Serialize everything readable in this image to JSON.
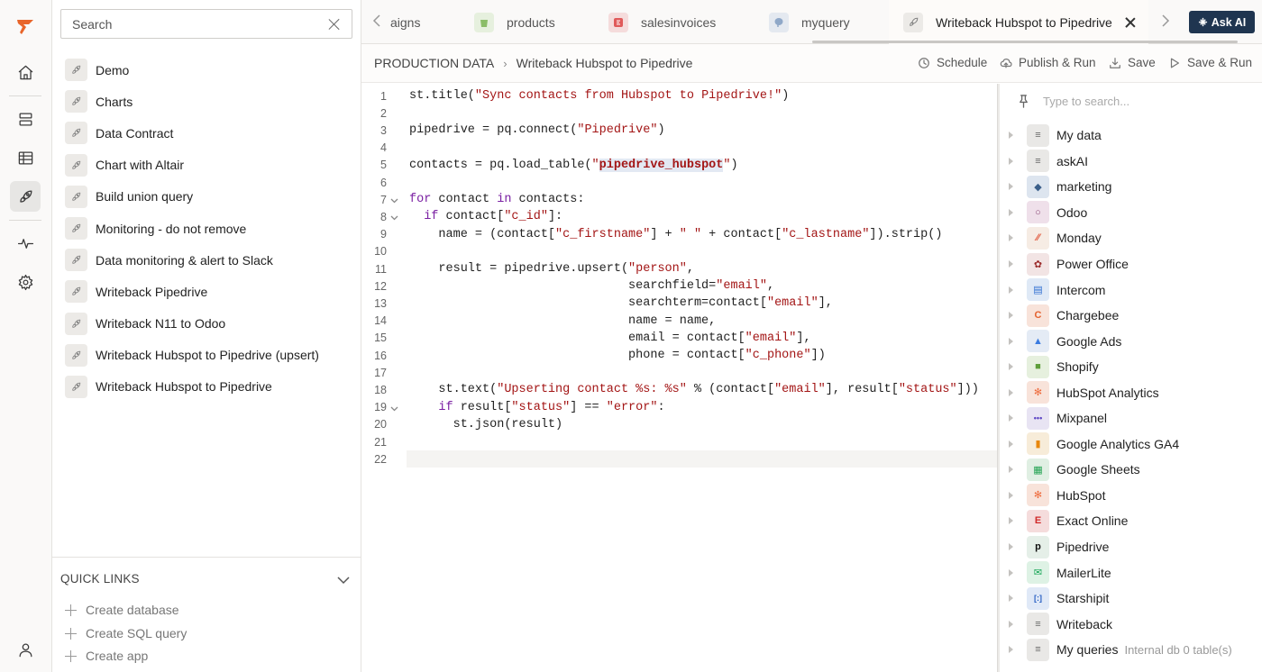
{
  "search": {
    "placeholder": "Search"
  },
  "apps": [
    {
      "label": "Demo"
    },
    {
      "label": "Charts"
    },
    {
      "label": "Data Contract"
    },
    {
      "label": "Chart with Altair"
    },
    {
      "label": "Build union query"
    },
    {
      "label": "Monitoring - do not remove"
    },
    {
      "label": "Data monitoring & alert to Slack"
    },
    {
      "label": "Writeback Pipedrive"
    },
    {
      "label": "Writeback N11 to Odoo"
    },
    {
      "label": "Writeback Hubspot to Pipedrive (upsert)"
    },
    {
      "label": "Writeback Hubspot to Pipedrive"
    }
  ],
  "quick_links": {
    "title": "QUICK LINKS",
    "items": [
      {
        "label": "Create database"
      },
      {
        "label": "Create SQL query"
      },
      {
        "label": "Create app"
      }
    ]
  },
  "tabs": [
    {
      "label": "aigns",
      "icon": "none"
    },
    {
      "label": "products",
      "icon": "shopify-icon"
    },
    {
      "label": "salesinvoices",
      "icon": "exact-online-icon"
    },
    {
      "label": "myquery",
      "icon": "postgres-icon"
    },
    {
      "label": "Writeback Hubspot to Pipedrive",
      "icon": "rocket-icon",
      "active": true
    }
  ],
  "ask_ai": {
    "label": "Ask AI"
  },
  "breadcrumb": {
    "root": "PRODUCTION DATA",
    "separator": "›",
    "current": "Writeback Hubspot to Pipedrive"
  },
  "toolbar": {
    "schedule": "Schedule",
    "publish_run": "Publish & Run",
    "save": "Save",
    "save_run": "Save & Run"
  },
  "editor": {
    "current_line": 22,
    "lines": [
      {
        "n": "1",
        "code": "st.title(\"Sync contacts from Hubspot to Pipedrive!\")"
      },
      {
        "n": "2",
        "code": ""
      },
      {
        "n": "3",
        "code": "pipedrive = pq.connect(\"Pipedrive\")"
      },
      {
        "n": "4",
        "code": ""
      },
      {
        "n": "5",
        "code": "contacts = pq.load_table(\"pipedrive_hubspot\")"
      },
      {
        "n": "6",
        "code": ""
      },
      {
        "n": "7",
        "code": "for contact in contacts:",
        "fold": true
      },
      {
        "n": "8",
        "code": "  if contact[\"c_id\"]:",
        "fold": true
      },
      {
        "n": "9",
        "code": "    name = (contact[\"c_firstname\"] + \" \" + contact[\"c_lastname\"]).strip()"
      },
      {
        "n": "10",
        "code": ""
      },
      {
        "n": "11",
        "code": "    result = pipedrive.upsert(\"person\","
      },
      {
        "n": "12",
        "code": "                              searchfield=\"email\","
      },
      {
        "n": "13",
        "code": "                              searchterm=contact[\"email\"],"
      },
      {
        "n": "14",
        "code": "                              name = name,"
      },
      {
        "n": "15",
        "code": "                              email = contact[\"email\"],"
      },
      {
        "n": "16",
        "code": "                              phone = contact[\"c_phone\"])"
      },
      {
        "n": "17",
        "code": ""
      },
      {
        "n": "18",
        "code": "    st.text(\"Upserting contact %s: %s\" % (contact[\"email\"], result[\"status\"]))"
      },
      {
        "n": "19",
        "code": "    if result[\"status\"] == \"error\":",
        "fold": true
      },
      {
        "n": "20",
        "code": "      st.json(result)"
      },
      {
        "n": "21",
        "code": ""
      },
      {
        "n": "22",
        "code": ""
      }
    ]
  },
  "data_panel": {
    "search_placeholder": "Type to search...",
    "items": [
      {
        "label": "My data",
        "icon": "database-icon",
        "bg": "#e9e8e6",
        "fg": "#666",
        "glyph": "≡"
      },
      {
        "label": "askAI",
        "icon": "database-icon",
        "bg": "#e9e8e6",
        "fg": "#666",
        "glyph": "≡"
      },
      {
        "label": "marketing",
        "icon": "postgres-icon",
        "bg": "#dde5ef",
        "fg": "#3b5f8a",
        "glyph": "◆"
      },
      {
        "label": "Odoo",
        "icon": "odoo-icon",
        "bg": "#efe0ea",
        "fg": "#8c4a78",
        "glyph": "○"
      },
      {
        "label": "Monday",
        "icon": "monday-icon",
        "bg": "#f6ece4",
        "fg": "#e0563b",
        "glyph": "⁄⁄"
      },
      {
        "label": "Power Office",
        "icon": "power-office-icon",
        "bg": "#f2e4e4",
        "fg": "#9b2a2a",
        "glyph": "✿"
      },
      {
        "label": "Intercom",
        "icon": "intercom-icon",
        "bg": "#dfe9f6",
        "fg": "#2f6fd1",
        "glyph": "▤"
      },
      {
        "label": "Chargebee",
        "icon": "chargebee-icon",
        "bg": "#f8e3da",
        "fg": "#e4622f",
        "glyph": "C"
      },
      {
        "label": "Google Ads",
        "icon": "google-ads-icon",
        "bg": "#e4ebf5",
        "fg": "#3a7be0",
        "glyph": "▲"
      },
      {
        "label": "Shopify",
        "icon": "shopify-icon",
        "bg": "#e6f0de",
        "fg": "#5e9e3a",
        "glyph": "■"
      },
      {
        "label": "HubSpot Analytics",
        "icon": "hubspot-icon",
        "bg": "#f8e3da",
        "fg": "#ee6b3c",
        "glyph": "✻"
      },
      {
        "label": "Mixpanel",
        "icon": "mixpanel-icon",
        "bg": "#e8e4f3",
        "fg": "#5b45c4",
        "glyph": "•••"
      },
      {
        "label": "Google Analytics GA4",
        "icon": "google-analytics-icon",
        "bg": "#f7ecd9",
        "fg": "#e8870c",
        "glyph": "▮"
      },
      {
        "label": "Google Sheets",
        "icon": "google-sheets-icon",
        "bg": "#e0efe3",
        "fg": "#22a352",
        "glyph": "▦"
      },
      {
        "label": "HubSpot",
        "icon": "hubspot-icon",
        "bg": "#f8e3da",
        "fg": "#ee6b3c",
        "glyph": "✻"
      },
      {
        "label": "Exact Online",
        "icon": "exact-online-icon",
        "bg": "#f5dcdc",
        "fg": "#d12a2a",
        "glyph": "E"
      },
      {
        "label": "Pipedrive",
        "icon": "pipedrive-icon",
        "bg": "#e5efe8",
        "fg": "#111",
        "glyph": "p"
      },
      {
        "label": "MailerLite",
        "icon": "mailerlite-icon",
        "bg": "#def2e5",
        "fg": "#12a453",
        "glyph": "✉"
      },
      {
        "label": "Starshipit",
        "icon": "starshipit-icon",
        "bg": "#e0e9f7",
        "fg": "#2a61c4",
        "glyph": "[:]"
      },
      {
        "label": "Writeback",
        "icon": "database-icon",
        "bg": "#e9e8e6",
        "fg": "#666",
        "glyph": "≡"
      },
      {
        "label": "My queries",
        "meta": "Internal db 0 table(s)",
        "icon": "database-icon",
        "bg": "#e9e8e6",
        "fg": "#666",
        "glyph": "≡"
      }
    ]
  },
  "colors": {
    "ask_ai_bg": "#1f3550",
    "string": "#a31515",
    "keyword": "#7a1fa2",
    "brand": "#e8652a"
  }
}
